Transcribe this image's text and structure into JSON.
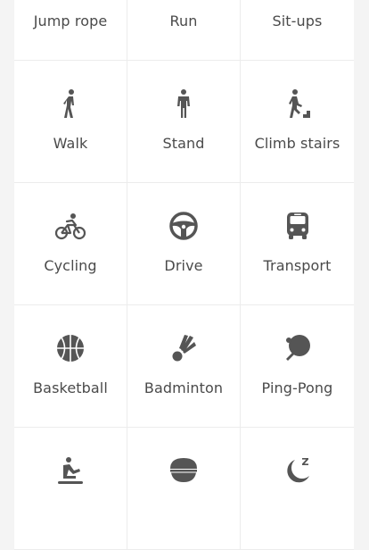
{
  "activities": [
    {
      "label": "Jump rope",
      "icon": "jump-rope-icon"
    },
    {
      "label": "Run",
      "icon": "run-icon"
    },
    {
      "label": "Sit-ups",
      "icon": "sit-ups-icon"
    },
    {
      "label": "Walk",
      "icon": "walk-icon"
    },
    {
      "label": "Stand",
      "icon": "stand-icon"
    },
    {
      "label": "Climb stairs",
      "icon": "climb-stairs-icon"
    },
    {
      "label": "Cycling",
      "icon": "cycling-icon"
    },
    {
      "label": "Drive",
      "icon": "steering-wheel-icon"
    },
    {
      "label": "Transport",
      "icon": "bus-icon"
    },
    {
      "label": "Basketball",
      "icon": "basketball-icon"
    },
    {
      "label": "Badminton",
      "icon": "shuttlecock-icon"
    },
    {
      "label": "Ping-Pong",
      "icon": "ping-pong-icon"
    },
    {
      "label": "",
      "icon": "rowing-icon"
    },
    {
      "label": "",
      "icon": "bowl-icon"
    },
    {
      "label": "",
      "icon": "sleep-moon-icon"
    }
  ],
  "colors": {
    "icon": "#555555",
    "label": "#4a4a4a",
    "background": "#f4f4f4",
    "tile": "#ffffff",
    "divider": "#ececec"
  }
}
